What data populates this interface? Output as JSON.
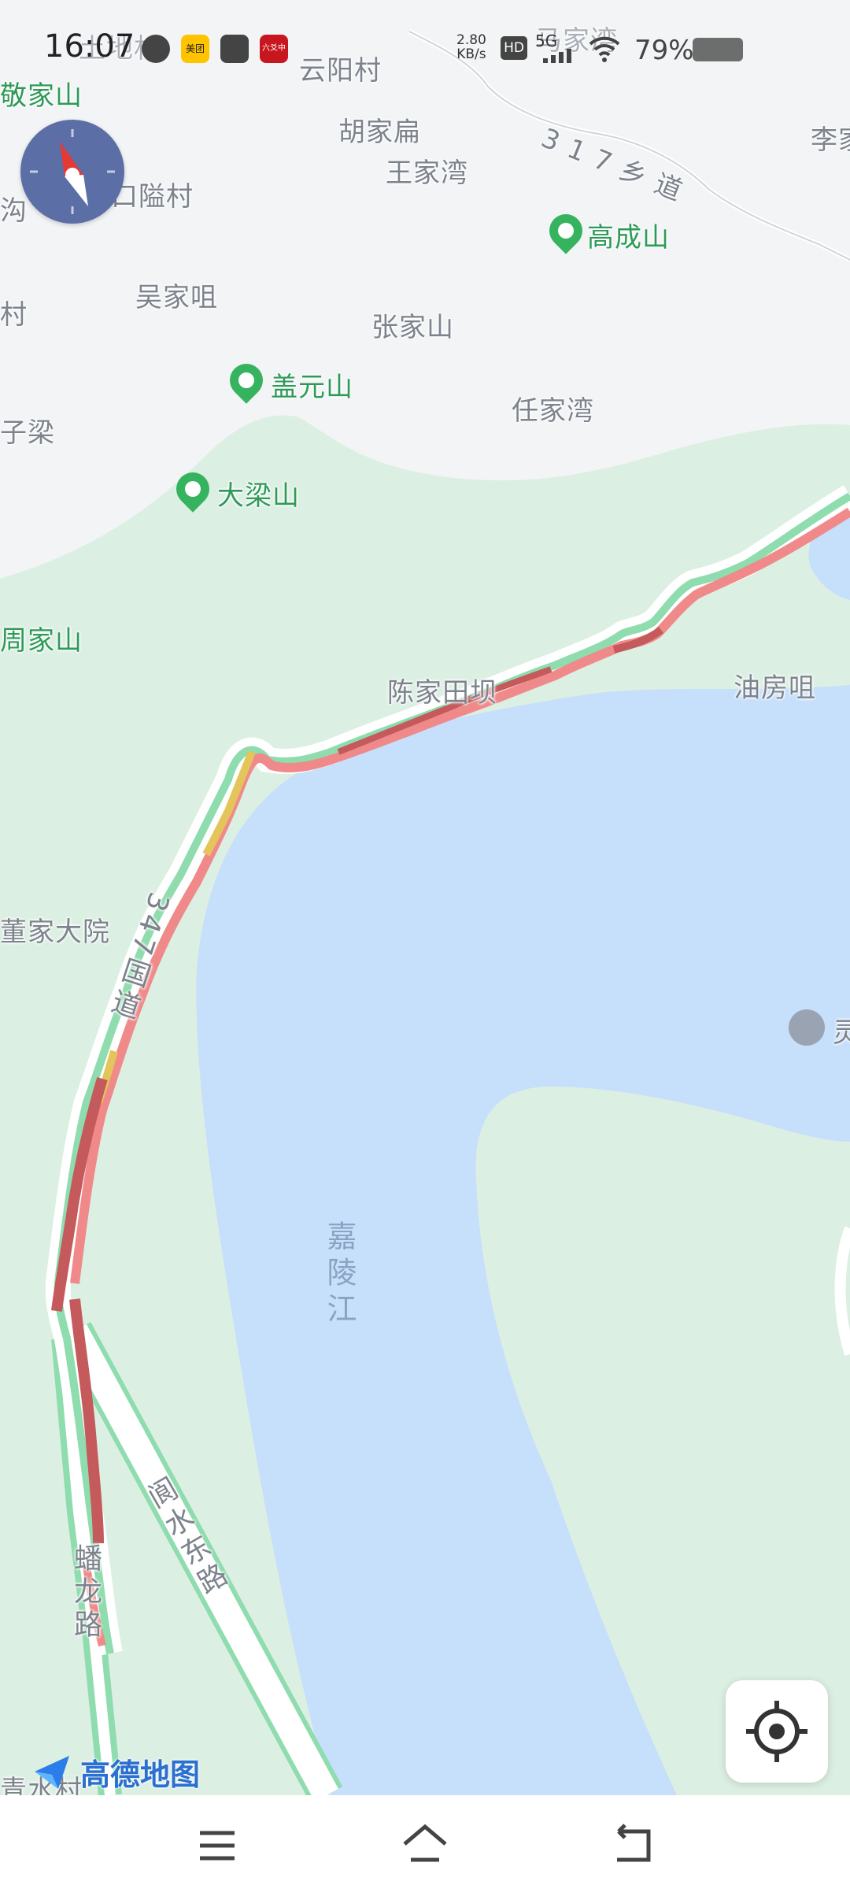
{
  "status_bar": {
    "time": "16:07",
    "net_speed_value": "2.80",
    "net_speed_unit": "KB/s",
    "hd_badge": "HD",
    "network_type": "5G",
    "battery_percent": "79%",
    "app_icons": [
      "video-icon",
      "meituan-icon",
      "mail-icon",
      "news-icon"
    ],
    "meituan_label": "美团",
    "news_label": "六爻中"
  },
  "map": {
    "place_labels": {
      "yunyang": "云阳村",
      "hujiabian": "胡家扁",
      "wangjiawan": "王家湾",
      "wakoulong": "瓦口隘村",
      "wujiazui": "吴家咀",
      "zhangjiashan": "张家山",
      "renjiawan": "任家湾",
      "jingjiashan": "敬家山",
      "majiawan": "马家湾",
      "li": "李家",
      "zhoujiashan": "周家山",
      "chenjiatianba": "陈家田坝",
      "youfangzui": "油房咀",
      "dongjiadayuan": "董家大院",
      "gou": "沟",
      "cun": "村",
      "ziliang": "子梁",
      "shuang": "灵",
      "qingshui": "青水村",
      "xiangcun": "土地村"
    },
    "peaks": {
      "gaochengshan": "高成山",
      "gaiyuanshan": "盖元山",
      "daliangshan": "大梁山"
    },
    "roads": {
      "county_road": "317乡道",
      "national_road": "347国道",
      "panlong": "蟠龙路",
      "langshui": "阆水东路"
    },
    "river": "嘉陵江",
    "brand": "高德地图",
    "colors": {
      "water": "#c6dffb",
      "green": "#dcefe3",
      "land": "#f2f4f6",
      "traffic_heavy": "#c45a5c",
      "traffic_slow": "#f08a8a",
      "traffic_amber": "#e3c55b",
      "traffic_clear": "#8fdcae"
    }
  },
  "controls": {
    "compass": "compass-icon",
    "locate": "locate-icon"
  },
  "nav": {
    "menu": "menu-icon",
    "home": "home-icon",
    "back": "back-icon"
  }
}
